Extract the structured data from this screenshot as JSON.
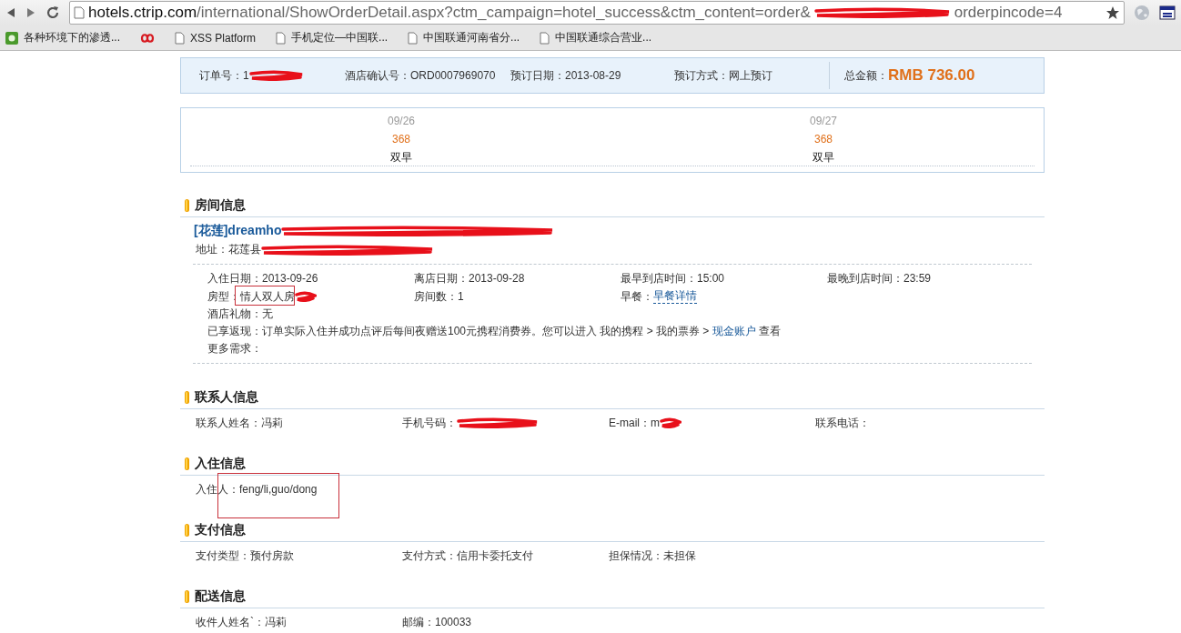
{
  "browser": {
    "url_host": "hotels.ctrip.com",
    "url_path": "/international/ShowOrderDetail.aspx?ctm_campaign=hotel_success&ctm_content=order&",
    "url_tail": "orderpincode=4"
  },
  "bookmarks": [
    {
      "label": "各种环境下的渗透...",
      "kind": "app"
    },
    {
      "kind": "logo"
    },
    {
      "label": "XSS Platform",
      "kind": "page"
    },
    {
      "label": "手机定位—中国联...",
      "kind": "page"
    },
    {
      "label": "中国联通河南省分...",
      "kind": "page"
    },
    {
      "label": "中国联通综合营业...",
      "kind": "page"
    }
  ],
  "summary": {
    "fields": [
      {
        "label": "订单号：",
        "value": "1",
        "redacted": true
      },
      {
        "label": "酒店确认号：",
        "value": "ORD0007969070"
      },
      {
        "label": "预订日期：",
        "value": "2013-08-29"
      },
      {
        "label": "预订方式：",
        "value": "网上预订"
      }
    ],
    "total": {
      "label": "总金额：",
      "value": "RMB 736.00"
    }
  },
  "nightly_prices": [
    {
      "date": "09/26",
      "price": "368",
      "breakfast": "双早"
    },
    {
      "date": "09/27",
      "price": "368",
      "breakfast": "双早"
    }
  ],
  "room": {
    "title": "房间信息",
    "hotel_name": "[花莲]dreamho",
    "address": "地址：花莲县",
    "details": [
      {
        "label": "入住日期：",
        "value": "2013-09-26",
        "kind": "text"
      },
      {
        "label": "离店日期：",
        "value": "2013-09-28",
        "kind": "text"
      },
      {
        "label": "最早到店时间：",
        "value": "15:00",
        "kind": "text"
      },
      {
        "label": "最晚到店时间：",
        "value": "23:59",
        "kind": "text"
      },
      {
        "label": "房型：",
        "value": "情人双人房",
        "kind": "text",
        "annotated": true,
        "redacted": true
      },
      {
        "label": "房间数：",
        "value": "1",
        "kind": "text"
      },
      {
        "label": "早餐：",
        "value": "早餐详情",
        "kind": "link"
      }
    ],
    "extras": [
      {
        "label": "酒店礼物：",
        "value": "无",
        "kind": "text"
      },
      {
        "label": "已享返现：",
        "value": "订单实际入住并成功点评后每间夜赠送100元携程消费券。您可以进入 我的携程 > 我的票券 > ",
        "link": "现金账户",
        "after": " 查看",
        "kind": "sentence"
      },
      {
        "label": "更多需求：",
        "kind": "text"
      }
    ]
  },
  "sections": [
    {
      "title": "联系人信息",
      "fields": [
        {
          "label": "联系人姓名：",
          "value": "冯莉"
        },
        {
          "label": "手机号码：",
          "redacted": true
        },
        {
          "label": "E-mail：",
          "value": "m",
          "redacted": true
        },
        {
          "label": "联系电话："
        }
      ]
    },
    {
      "title": "入住信息",
      "fields": [
        {
          "label": "入住人：",
          "value": "feng/li,guo/dong",
          "annotated": true
        }
      ]
    },
    {
      "title": "支付信息",
      "fields": [
        {
          "label": "支付类型：",
          "value": "预付房款"
        },
        {
          "label": "支付方式：",
          "value": "信用卡委托支付"
        },
        {
          "label": "担保情况：",
          "value": "未担保"
        }
      ]
    },
    {
      "title": "配送信息",
      "fields": [
        {
          "label": "收件人姓名`：",
          "value": "冯莉"
        },
        {
          "label": "邮编：",
          "value": "100033"
        }
      ]
    }
  ]
}
